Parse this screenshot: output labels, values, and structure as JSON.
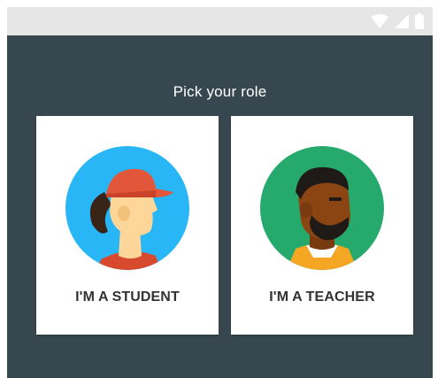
{
  "status_bar": {
    "icons": [
      "wifi-icon",
      "cell-signal-icon",
      "battery-icon"
    ]
  },
  "page": {
    "title": "Pick your role"
  },
  "roles": [
    {
      "label": "I'M A STUDENT",
      "icon": "student-avatar-icon"
    },
    {
      "label": "I'M A TEACHER",
      "icon": "teacher-avatar-icon"
    }
  ],
  "colors": {
    "background": "#37474f",
    "card": "#ffffff",
    "student_circle": "#29b6f6",
    "teacher_circle": "#26a96c",
    "cap": "#e2573a"
  }
}
